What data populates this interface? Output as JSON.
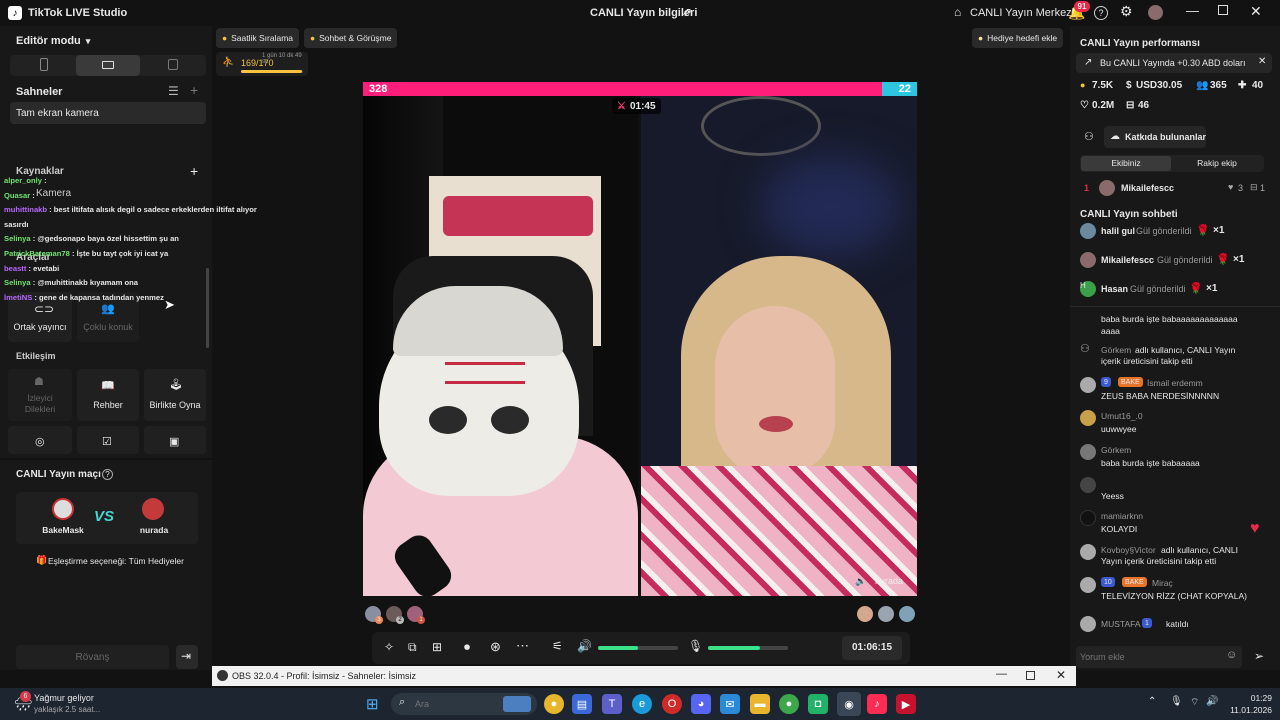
{
  "app": {
    "title": "TikTok LIVE Studio",
    "center_title": "CANLI Yayın bilgileri",
    "live_center": "CANLI Yayın Merkezi",
    "notif_count": "91"
  },
  "left": {
    "editor_mode": "Editör modu",
    "scenes_title": "Sahneler",
    "scene_item": "Tam ekran kamera",
    "sources_title": "Kaynaklar",
    "source_item": "Kamera",
    "tools_title": "Araçlar",
    "tool_cohost": "Ortak yayıncı",
    "tool_multi": "Çoklu konuk",
    "interaction_title": "Etkileşim",
    "int_viewer": "İzleyici Dilekleri",
    "int_guide": "Rehber",
    "int_play": "Birlikte Oyna",
    "match_title": "CANLI Yayın maçı",
    "player1": "BakeMask",
    "player2": "nurada",
    "vs": "VS",
    "matching_option": "Eşleştirme seçeneği: Tüm Hediyeler",
    "rematch": "Rövanş"
  },
  "overlay_chat": [
    {
      "user": "alper_only",
      "text": " :"
    },
    {
      "user": "Quasar",
      "text": " :"
    },
    {
      "user": "muhittinakb",
      "text": " : best iltifata alısık degil o sadece erkeklerden iltifat alıyor sasırdı"
    },
    {
      "user": "Selinya",
      "text": " : @gedsonapo baya özel hissettim şu an"
    },
    {
      "user": "PatrickBateman78",
      "text": " : İşte bu tayt çok iyi icat ya"
    },
    {
      "user": "beastt",
      "text": " : evetabi"
    },
    {
      "user": "Selinya",
      "text": " : @muhittinakb kıyamam ona"
    },
    {
      "user": "İmetiNS",
      "text": " : gene de kapansa tadından yenmez"
    }
  ],
  "center": {
    "tab_ranking": "Saatlik Sıralama",
    "tab_chat": "Sohbet & Görüşme",
    "gift_goal": "Hediye hedefi ekle",
    "progress_text": "169/170",
    "progress_fraction": 0.99,
    "progress_sub": "1 gün 10 dk 49 sn",
    "score_left": "328",
    "score_right": "22",
    "score_left_fraction": 0.937,
    "battle_timer": "01:45",
    "right_name": "nurada",
    "left_badge_counts": [
      "3",
      "2",
      "1"
    ],
    "timer": "01:06:15",
    "volume_level": 0.5,
    "mic_level": 0.65
  },
  "right": {
    "perf_title": "CANLI Yayın performansı",
    "perf_note": "Bu CANLI Yayında +0.30 ABD doları",
    "stat_coins": "7.5K",
    "stat_usd": "USD30.05",
    "stat_viewers": "365",
    "stat_new": "40",
    "stat_likes": "0.2M",
    "stat_gifts": "46",
    "contributors_btn": "Katkıda bulunanlar",
    "tab_team": "Ekibiniz",
    "tab_rival": "Rakip ekip",
    "rank_num": "1",
    "rank_user": "Mikailefescc",
    "rank_likes": "3",
    "rank_gifts": "1",
    "chat_title": "CANLI Yayın sohbeti",
    "gift_rows": [
      {
        "user": "halil gul",
        "text": "Gül gönderildi",
        "count": "×1"
      },
      {
        "user": "Mikailefescc",
        "text": "Gül gönderildi",
        "count": "×1"
      },
      {
        "user": "Hasan",
        "text": "Gül gönderildi",
        "count": "×1"
      }
    ],
    "messages": [
      {
        "user": "",
        "text": "baba burda işte babaaaaaaaaaaaaaaaaa"
      },
      {
        "user": "Görkem",
        "text": "adlı kullanıcı, CANLI Yayın içerik üreticisini takip etti"
      },
      {
        "user": "İsmail erdemm",
        "text": "ZEUS BABA NERDESİNNNNN",
        "lvl": "9",
        "badge": "BAKE"
      },
      {
        "user": "Umut16_.0",
        "text": "uuwwyee"
      },
      {
        "user": "Görkem",
        "text": "baba burda işte babaaaaa"
      },
      {
        "user": "",
        "text": "Yeess"
      },
      {
        "user": "mamiarknn",
        "text": "KOLAYDI"
      },
      {
        "user": "Kovboy§Victor",
        "text": "adlı kullanıcı, CANLI Yayın içerik üreticisini takip etti"
      },
      {
        "user": "Miraç",
        "text": "TELEVİZYON RİZZ (CHAT KOPYALA)",
        "lvl": "10",
        "badge": "BAKE"
      },
      {
        "user": "MUSTAFA",
        "text": "katıldı",
        "lvl": "1"
      }
    ],
    "comment_placeholder": "Yorum ekle"
  },
  "obs": {
    "title": "OBS 32.0.4 - Profil: İsimsiz - Sahneler: İsimsiz"
  },
  "taskbar": {
    "weather_title": "Yağmur geliyor",
    "weather_sub": "yaklaşık 2.5 saat...",
    "weather_badge": "6",
    "search_placeholder": "Ara",
    "time": "01:29",
    "date": "11.01.2026"
  }
}
